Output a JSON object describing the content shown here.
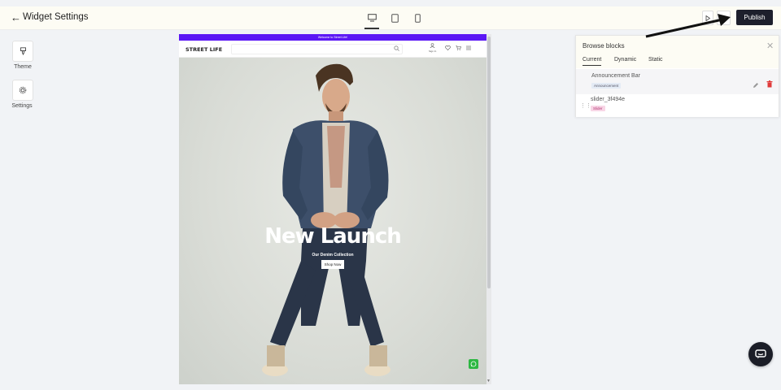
{
  "topbar": {
    "title": "Widget Settings",
    "devices": [
      "desktop-icon",
      "tablet-icon",
      "mobile-icon"
    ],
    "active_device": "desktop",
    "publish_label": "Publish"
  },
  "rail": {
    "items": [
      {
        "label": "Theme",
        "icon": "brush-icon"
      },
      {
        "label": "Settings",
        "icon": "gear-icon"
      }
    ]
  },
  "preview": {
    "announcement": "Welcome to Street Life!",
    "logo": "STREET LIFE",
    "signin": "Sign In",
    "hero_title": "New Launch",
    "hero_subtitle": "Our Denim Collection",
    "cta": "Shop Now",
    "accent": "#5b17f5"
  },
  "panel": {
    "title": "Browse blocks",
    "tabs": [
      "Current",
      "Dynamic",
      "Static"
    ],
    "active_tab": "Current",
    "blocks": [
      {
        "name": "Announcement Bar",
        "badge": "Announcement",
        "badge_color": "#e4ebf5"
      },
      {
        "name": "slider_3f494e",
        "badge": "Slider",
        "badge_color": "#f8d6e6"
      }
    ]
  }
}
